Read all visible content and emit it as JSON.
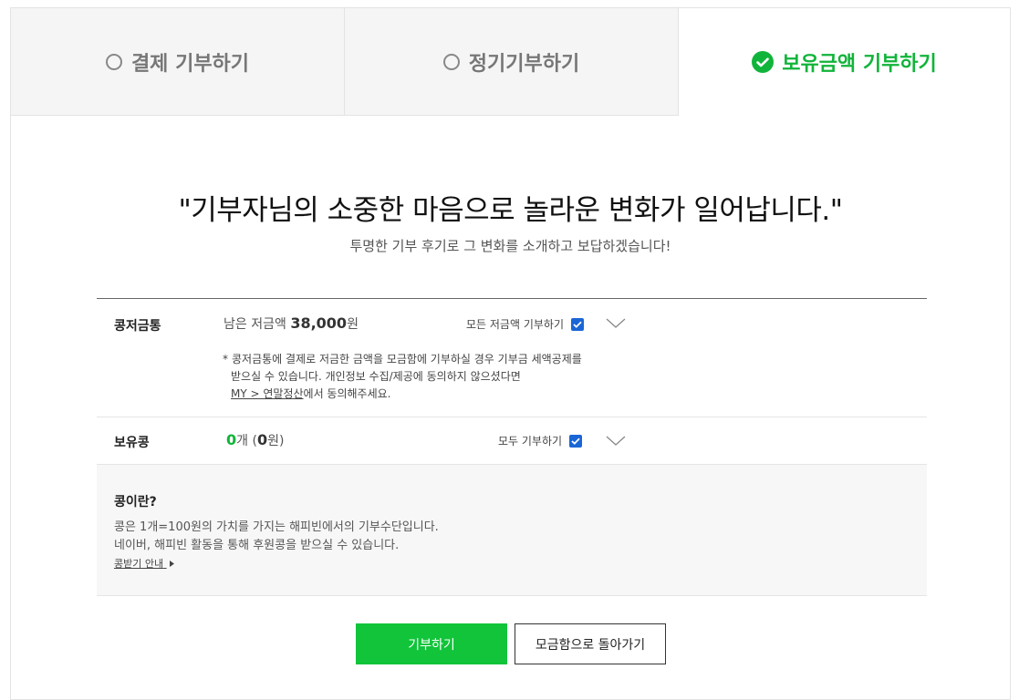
{
  "tabs": [
    {
      "label": "결제 기부하기",
      "active": false
    },
    {
      "label": "정기기부하기",
      "active": false
    },
    {
      "label": "보유금액 기부하기",
      "active": true
    }
  ],
  "headline": "\"기부자님의 소중한 마음으로 놀라운 변화가 일어납니다.\"",
  "subline": "투명한 기부 후기로 그 변화를 소개하고 보답하겠습니다!",
  "piggy": {
    "label": "콩저금통",
    "amount_prefix": "남은 저금액",
    "amount_value": "38,000",
    "amount_unit": "원",
    "all_donate_label": "모든 저금액 기부하기",
    "checked": true,
    "note_star": "*",
    "note_line1": "콩저금통에 결제로 저금한 금액을 모금함에 기부하실 경우 기부금 세액공제를",
    "note_line2": "받으실 수 있습니다. 개인정보 수집/제공에 동의하지 않으셨다면",
    "note_link": "MY > 연말정산",
    "note_line3_suffix": "에서 동의해주세요."
  },
  "beans": {
    "label": "보유콩",
    "count": "0",
    "count_unit": "개",
    "won_open": "(",
    "won_value": "0",
    "won_unit": "원)",
    "all_donate_label": "모두 기부하기",
    "checked": true
  },
  "info": {
    "title": "콩이란?",
    "line1": "콩은 1개=100원의 가치를 가지는 해피빈에서의 기부수단입니다.",
    "line2": "네이버, 해피빈 활동을 통해 후원콩을 받으실 수 있습니다.",
    "link": "콩받기 안내"
  },
  "buttons": {
    "donate": "기부하기",
    "back": "모금함으로 돌아가기"
  },
  "colors": {
    "accent": "#11b43a",
    "checkbox": "#1a66d6"
  }
}
